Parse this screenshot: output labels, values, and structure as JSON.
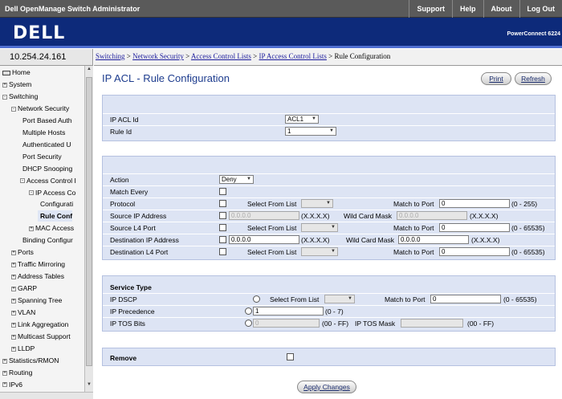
{
  "app_title": "Dell OpenManage Switch Administrator",
  "top_nav": [
    "Support",
    "Help",
    "About",
    "Log Out"
  ],
  "brand": {
    "logo": "DELL",
    "model": "PowerConnect 6224"
  },
  "ip_address": "10.254.24.161",
  "breadcrumb": {
    "links": [
      "Switching",
      "Network Security",
      "Access Control Lists",
      "IP Access Control Lists"
    ],
    "separator": " > ",
    "current": "Rule Configuration"
  },
  "sidebar": {
    "items": [
      {
        "label": "Home",
        "toggle": ""
      },
      {
        "label": "System",
        "toggle": "+"
      },
      {
        "label": "Switching",
        "toggle": "-"
      },
      {
        "label": "Network Security",
        "toggle": "-"
      },
      {
        "label": "Port Based Auth",
        "toggle": ""
      },
      {
        "label": "Multiple Hosts",
        "toggle": ""
      },
      {
        "label": "Authenticated U",
        "toggle": ""
      },
      {
        "label": "Port Security",
        "toggle": ""
      },
      {
        "label": "DHCP Snooping",
        "toggle": ""
      },
      {
        "label": "Access Control I",
        "toggle": "-"
      },
      {
        "label": "IP Access Co",
        "toggle": "-"
      },
      {
        "label": "Configurati",
        "toggle": ""
      },
      {
        "label": "Rule Conf",
        "toggle": ""
      },
      {
        "label": "MAC Access",
        "toggle": "+"
      },
      {
        "label": "Binding Configur",
        "toggle": ""
      },
      {
        "label": "Ports",
        "toggle": "+"
      },
      {
        "label": "Traffic Mirroring",
        "toggle": "+"
      },
      {
        "label": "Address Tables",
        "toggle": "+"
      },
      {
        "label": "GARP",
        "toggle": "+"
      },
      {
        "label": "Spanning Tree",
        "toggle": "+"
      },
      {
        "label": "VLAN",
        "toggle": "+"
      },
      {
        "label": "Link Aggregation",
        "toggle": "+"
      },
      {
        "label": "Multicast Support",
        "toggle": "+"
      },
      {
        "label": "LLDP",
        "toggle": "+"
      },
      {
        "label": "Statistics/RMON",
        "toggle": "+"
      },
      {
        "label": "Routing",
        "toggle": "+"
      },
      {
        "label": "IPv6",
        "toggle": "+"
      }
    ],
    "selected_index": 12
  },
  "page": {
    "title": "IP ACL - Rule Configuration",
    "print_label": "Print",
    "refresh_label": "Refresh",
    "apply_label": "Apply Changes"
  },
  "acl_panel": {
    "acl_id_label": "IP ACL Id",
    "acl_id_value": "ACL1",
    "rule_id_label": "Rule Id",
    "rule_id_value": "1"
  },
  "rule_panel": {
    "action_label": "Action",
    "action_value": "Deny",
    "match_every_label": "Match Every",
    "protocol_label": "Protocol",
    "select_from_list_label": "Select From List",
    "match_to_port_label": "Match to Port",
    "protocol_match_value": "0",
    "protocol_range": "(0 - 255)",
    "src_ip_label": "Source IP Address",
    "src_ip_value": "0.0.0.0",
    "ip_format": "(X.X.X.X)",
    "wildcard_label": "Wild Card Mask",
    "src_mask_value": "0.0.0.0",
    "src_l4_label": "Source L4 Port",
    "src_l4_match_value": "0",
    "port_range": "(0 - 65535)",
    "dst_ip_label": "Destination IP Address",
    "dst_ip_value": "0.0.0.0",
    "dst_mask_value": "0.0.0.0",
    "dst_l4_label": "Destination L4 Port",
    "dst_l4_match_value": "0"
  },
  "service_panel": {
    "heading": "Service Type",
    "dscp_label": "IP DSCP",
    "select_from_list_label": "Select From List",
    "match_to_port_label": "Match to Port",
    "dscp_match_value": "0",
    "port_range": "(0 - 65535)",
    "precedence_label": "IP Precedence",
    "precedence_value": "1",
    "precedence_range": "(0 - 7)",
    "tos_label": "IP TOS Bits",
    "tos_value": "0",
    "tos_range": "(00 - FF)",
    "tos_mask_label": "IP TOS Mask",
    "tos_mask_range": "(00 - FF)"
  },
  "remove_panel": {
    "label": "Remove"
  }
}
